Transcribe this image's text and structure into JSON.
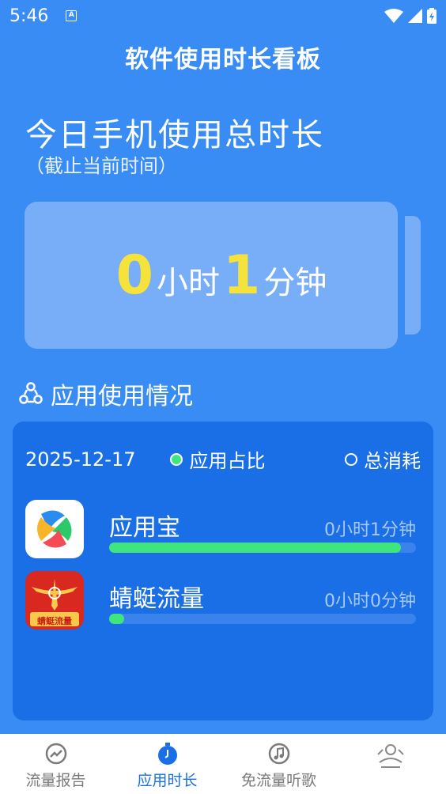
{
  "status": {
    "time": "5:46",
    "a_badge": "A"
  },
  "header": {
    "title": "软件使用时长看板"
  },
  "today": {
    "title": "今日手机使用总时长",
    "subtitle": "（截止当前时间）",
    "hours": "0",
    "hours_unit": "小时",
    "minutes": "1",
    "minutes_unit": "分钟"
  },
  "section": {
    "title": "应用使用情况"
  },
  "panel": {
    "date": "2025-12-17",
    "legend_ratio": "应用占比",
    "legend_total": "总消耗",
    "apps": [
      {
        "name": "应用宝",
        "time": "0小时1分钟",
        "ratio": 0.95
      },
      {
        "name": "蜻蜓流量",
        "time": "0小时0分钟",
        "ratio": 0.05,
        "icon_text": "蜻蜓流量"
      }
    ]
  },
  "nav": {
    "items": [
      {
        "label": "流量报告",
        "icon": "trend-icon"
      },
      {
        "label": "应用时长",
        "icon": "clock-icon",
        "active": true
      },
      {
        "label": "免流量听歌",
        "icon": "music-icon"
      },
      {
        "label": "",
        "icon": "profile-icon"
      }
    ]
  },
  "colors": {
    "background": "#3a8cf5",
    "panel": "#1a6fe6",
    "accent_yellow": "#f5e33b",
    "bar_green": "#3ee67d"
  }
}
